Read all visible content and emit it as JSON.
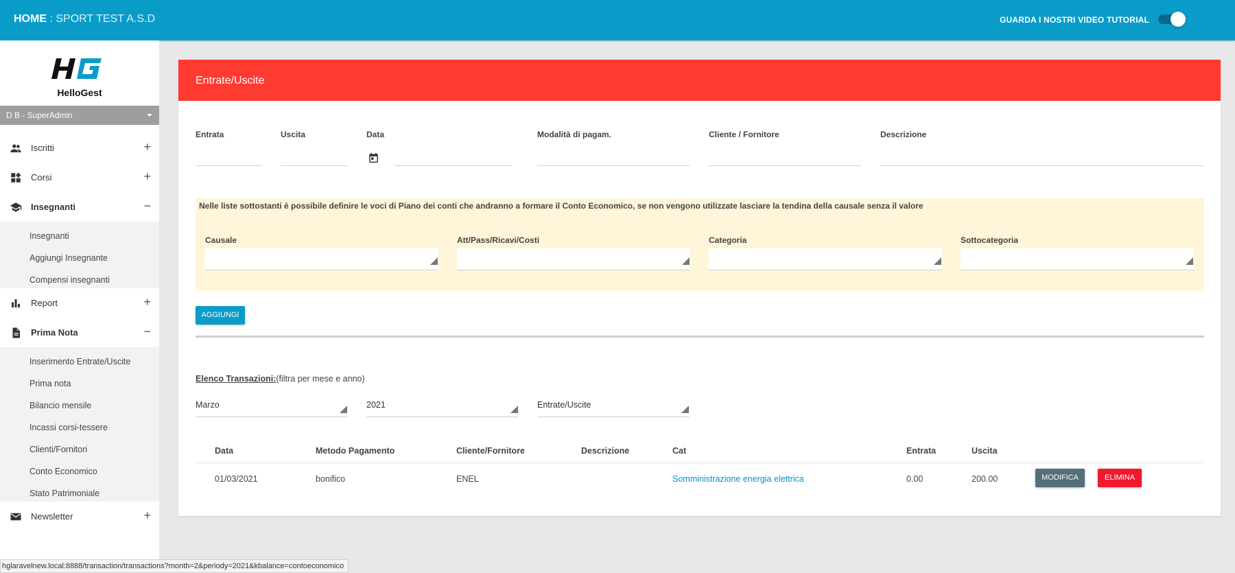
{
  "topbar": {
    "home": "HOME",
    "separator": " : ",
    "org": "SPORT TEST A.S.D",
    "tutorial": "GUARDA I NOSTRI VIDEO TUTORIAL",
    "toggle_on": true
  },
  "sidebar": {
    "app_name": "HelloGest",
    "user": "D B - SuperAdmin",
    "items": [
      {
        "label": "Iscritti",
        "icon": "people-icon",
        "expanded": false
      },
      {
        "label": "Corsi",
        "icon": "dashboard-icon",
        "expanded": false
      },
      {
        "label": "Insegnanti",
        "icon": "school-icon",
        "expanded": true,
        "children": [
          "Insegnanti",
          "Aggiungi Insegnante",
          "Compensi insegnanti"
        ]
      },
      {
        "label": "Report",
        "icon": "bar-chart-icon",
        "expanded": false
      },
      {
        "label": "Prima Nota",
        "icon": "document-icon",
        "expanded": true,
        "children": [
          "Inserimento Entrate/Uscite",
          "Prima nota",
          "Bilancio mensile",
          "Incassi corsi-tessere",
          "Clienti/Fornitori",
          "Conto Economico",
          "Stato Patrimoniale"
        ]
      },
      {
        "label": "Newsletter",
        "icon": "mail-icon",
        "expanded": false
      }
    ]
  },
  "card": {
    "title": "Entrate/Uscite",
    "fields": {
      "entrata": "Entrata",
      "uscita": "Uscita",
      "data": "Data",
      "modalita": "Modalità di pagam.",
      "cliente": "Cliente / Fornitore",
      "descrizione": "Descrizione"
    },
    "notice": "Nelle liste sottostanti è possibile definire le voci di Piano dei conti che andranno a formare il Conto Economico, se non vengono utilizzate lasciare la tendina della causale senza il valore",
    "selects": {
      "causale": "Causale",
      "att": "Att/Pass/Ricavi/Costi",
      "categoria": "Categoria",
      "sottocategoria": "Sottocategoria"
    },
    "add_button": "AGGIUNGI",
    "list_title": "Elenco Transazioni:",
    "list_hint": "(filtra per mese e anno)",
    "filters": {
      "month": "Marzo",
      "year": "2021",
      "type": "Entrate/Uscite"
    },
    "table": {
      "headers": [
        "Data",
        "Metodo Pagamento",
        "Cliente/Fornitore",
        "Descrizione",
        "Cat",
        "Entrata",
        "Uscita"
      ],
      "rows": [
        {
          "data": "01/03/2021",
          "metodo": "bonifico",
          "cliente": "ENEL",
          "descrizione": "",
          "cat": "Somministrazione energia elettrica",
          "entrata": "0.00",
          "uscita": "200.00"
        }
      ],
      "edit_label": "MODIFICA",
      "delete_label": "ELIMINA"
    }
  },
  "statusbar": "hglaravelnew.local:8888/transaction/transactions?month=2&periody=2021&kbalance=contoeconomico",
  "colors": {
    "primary": "#0a9cc9",
    "header_red": "#fe3a31",
    "notice_bg": "#fff5d9",
    "delete": "#f0192f",
    "edit": "#546e7a"
  }
}
